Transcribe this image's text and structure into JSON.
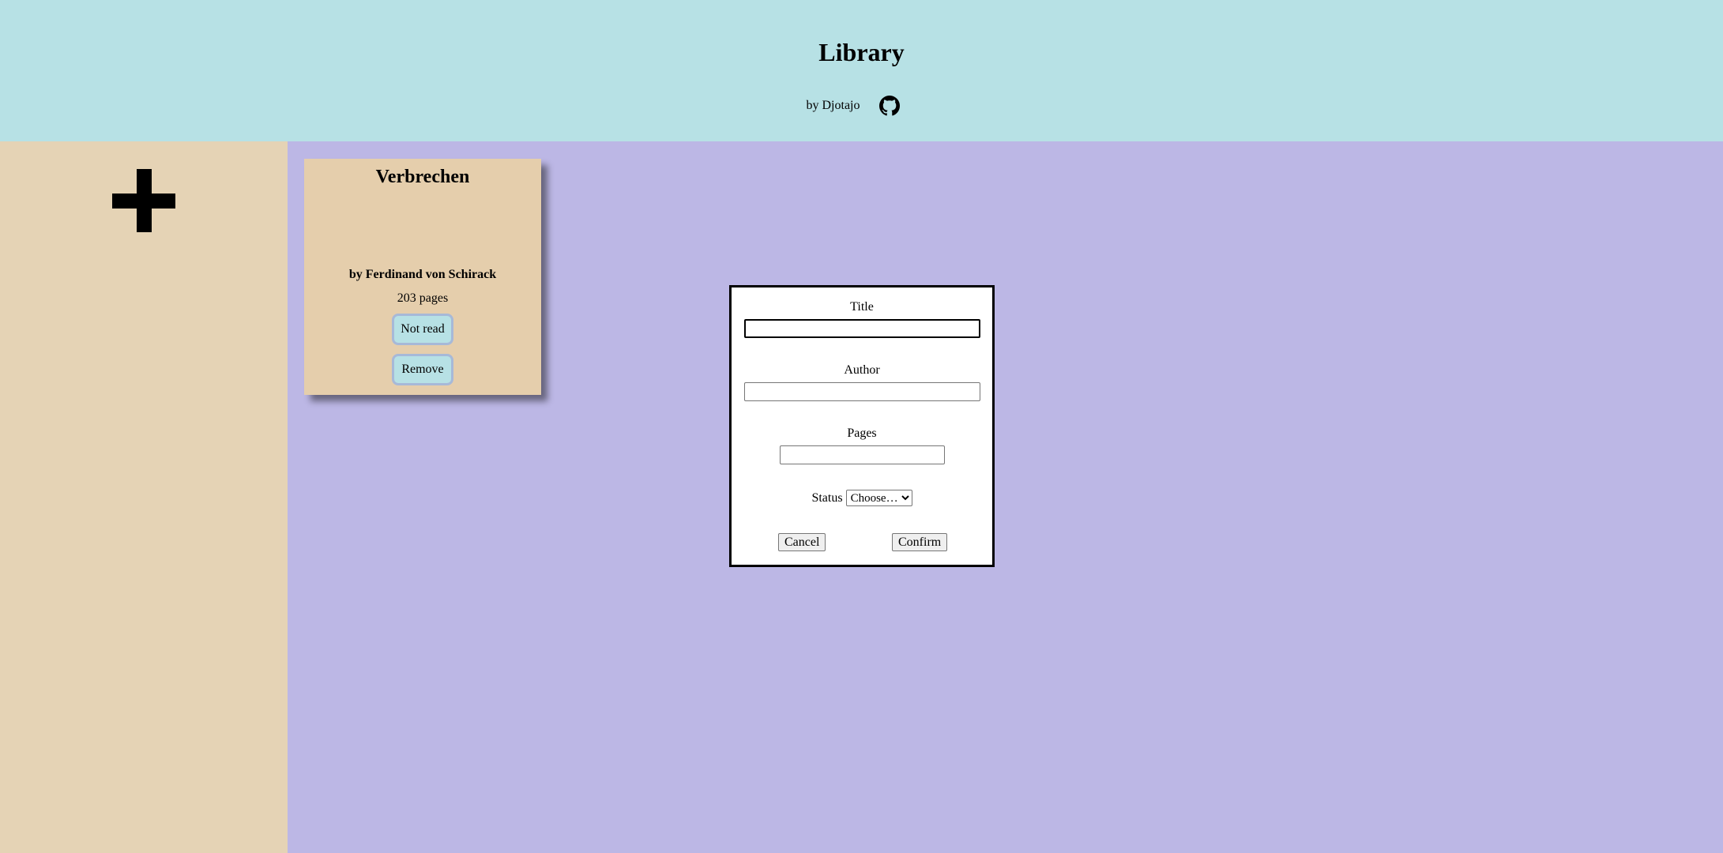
{
  "header": {
    "title": "Library",
    "byline": "by Djotajo",
    "github_icon": "github-icon"
  },
  "sidebar": {
    "add_icon": "plus-icon"
  },
  "books": [
    {
      "title": "Verbrechen",
      "author": "by Ferdinand von Schirack",
      "pages": "203 pages",
      "status_label": "Not read",
      "remove_label": "Remove"
    }
  ],
  "modal": {
    "title_label": "Title",
    "title_value": "",
    "author_label": "Author",
    "author_value": "",
    "pages_label": "Pages",
    "pages_value": "",
    "status_label": "Status",
    "status_selected": "Choose…",
    "cancel_label": "Cancel",
    "confirm_label": "Confirm"
  },
  "colors": {
    "header_bg": "#b7e1e5",
    "sidebar_bg": "#e5d3b5",
    "main_bg": "#bcb7e5",
    "card_bg": "#e5ceac",
    "card_button_bg": "#b7e1e5"
  }
}
